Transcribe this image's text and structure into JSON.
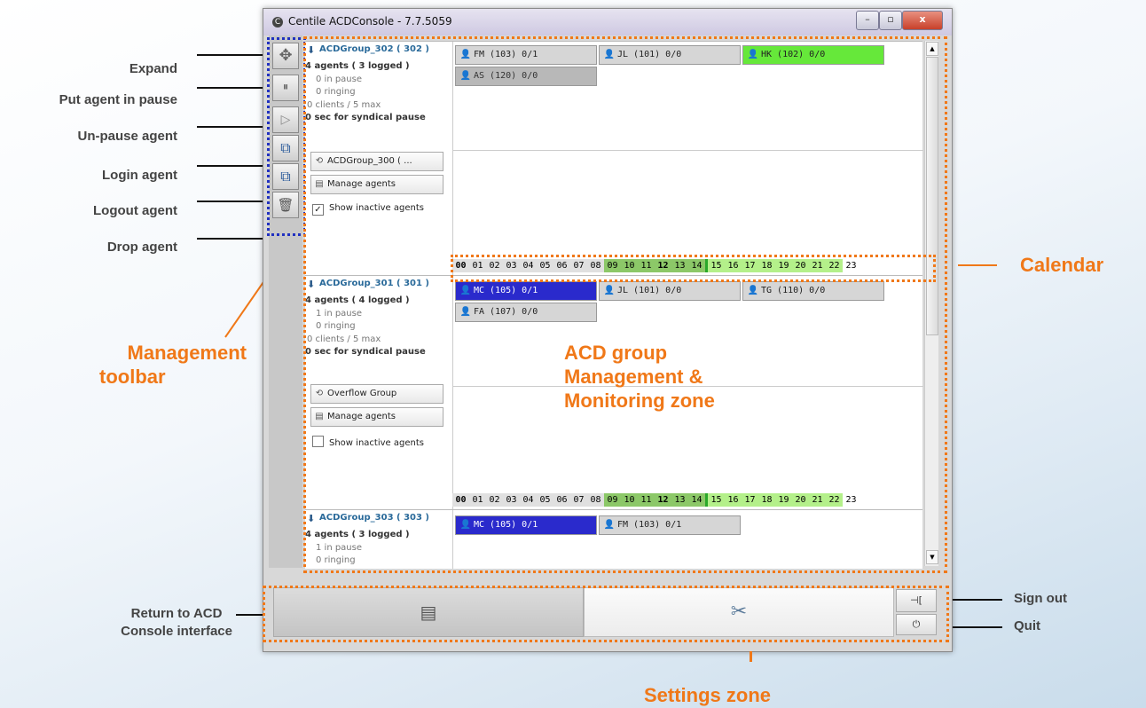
{
  "window": {
    "title": "Centile ACDConsole - 7.7.5059",
    "icon": "C",
    "min_label": "–",
    "max_label": "▫",
    "close_label": "x"
  },
  "annotations": {
    "expand": "Expand",
    "pause": "Put agent in pause",
    "unpause": "Un-pause agent",
    "login": "Login agent",
    "logout": "Logout agent",
    "drop": "Drop agent",
    "management_toolbar_line1": "Management",
    "management_toolbar_line2": "toolbar",
    "calendar": "Calendar",
    "acd_zone_line1": "ACD group",
    "acd_zone_line2": "Management &",
    "acd_zone_line3": "Monitoring zone",
    "return_line1": "Return to ACD",
    "return_line2": "Console interface",
    "sign_out": "Sign out",
    "quit": "Quit",
    "settings_zone": "Settings zone"
  },
  "toolbar_icons": {
    "expand": "✥",
    "pause": "⏸",
    "play": "▷",
    "login": "⧉",
    "logout": "⧉",
    "drop": "🗑"
  },
  "groups": [
    {
      "name": "ACDGroup_302 ( 302 )",
      "agents_line": "4 agents ( 3 logged )",
      "pause_line": "0 in pause",
      "ringing_line": "0 ringing",
      "clients_line": "0 clients / 5 max",
      "syndical_line": "0 sec for syndical pause",
      "overflow_label": "ACDGroup_300 ( ...",
      "manage_label": "Manage agents",
      "show_inactive_label": "Show inactive agents",
      "show_inactive_checked": "✓",
      "agents": [
        "FM (103)  0/1",
        "JL (101)  0/0",
        "HK (102)  0/0",
        "AS (120)  0/0"
      ]
    },
    {
      "name": "ACDGroup_301 ( 301 )",
      "agents_line": "4 agents ( 4 logged )",
      "pause_line": "1 in pause",
      "ringing_line": "0 ringing",
      "clients_line": "0 clients / 5 max",
      "syndical_line": "0 sec for syndical pause",
      "overflow_label": "Overflow Group",
      "manage_label": "Manage agents",
      "show_inactive_label": "Show inactive agents",
      "show_inactive_checked": "",
      "agents": [
        "MC (105)  0/1",
        "JL (101)  0/0",
        "TG (110)  0/0",
        "FA (107)  0/0"
      ]
    },
    {
      "name": "ACDGroup_303 ( 303 )",
      "agents_line": "4 agents ( 3 logged )",
      "pause_line": "1 in pause",
      "ringing_line": "0 ringing",
      "agents": [
        "MC (105)  0/1",
        "FM (103)  0/1"
      ]
    }
  ],
  "calendar_hours": [
    "00",
    "01",
    "02",
    "03",
    "04",
    "05",
    "06",
    "07",
    "08",
    "09",
    "10",
    "11",
    "12",
    "13",
    "14",
    "15",
    "16",
    "17",
    "18",
    "19",
    "20",
    "21",
    "22",
    "23"
  ],
  "settings": {
    "console_icon": "▤",
    "tools_icon": "✂",
    "signout_icon": "⊣[",
    "quit_icon": "⏻"
  },
  "colors": {
    "accent_orange": "#f07818",
    "toolbar_outline": "#2030c0",
    "agent_available": "#66e83a",
    "agent_busy": "#2a2acc"
  }
}
